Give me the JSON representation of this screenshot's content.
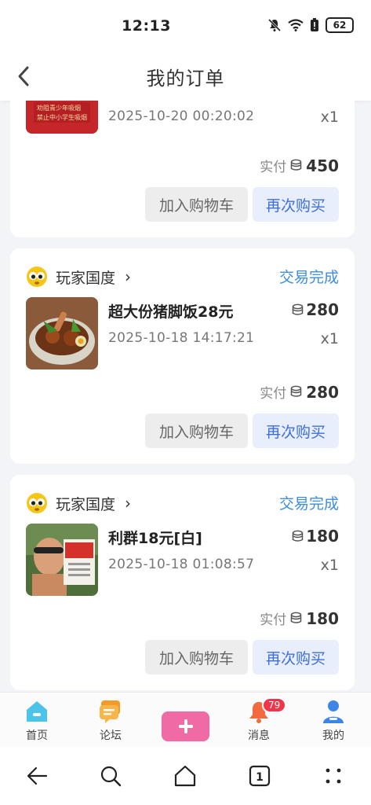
{
  "status_bar": {
    "time": "12:13",
    "battery": "62"
  },
  "header": {
    "title": "我的订单",
    "back_icon": "chevron-left-icon"
  },
  "orders": [
    {
      "shop_name": "",
      "status": "",
      "product_name": "",
      "price": "",
      "time": "2025-10-20 00:20:02",
      "qty": "x1",
      "paid_label": "实付",
      "paid_amount": "450",
      "cart_button": "加入购物车",
      "rebuy_button": "再次购买",
      "thumb_text": [
        "劝阻青少年吸烟",
        "禁止中小学生吸烟"
      ]
    },
    {
      "shop_name": "玩家国度",
      "status": "交易完成",
      "product_name": "超大份猪脚饭28元",
      "price": "280",
      "time": "2025-10-18 14:17:21",
      "qty": "x1",
      "paid_label": "实付",
      "paid_amount": "280",
      "cart_button": "加入购物车",
      "rebuy_button": "再次购买"
    },
    {
      "shop_name": "玩家国度",
      "status": "交易完成",
      "product_name": "利群18元[白]",
      "price": "180",
      "time": "2025-10-18 01:08:57",
      "qty": "x1",
      "paid_label": "实付",
      "paid_amount": "180",
      "cart_button": "加入购物车",
      "rebuy_button": "再次购买"
    }
  ],
  "bottom_nav": {
    "items": [
      {
        "label": "首页",
        "icon": "home-icon"
      },
      {
        "label": "论坛",
        "icon": "forum-icon"
      },
      {
        "label": "",
        "icon": "plus-icon"
      },
      {
        "label": "消息",
        "icon": "bell-icon",
        "badge": "79"
      },
      {
        "label": "我的",
        "icon": "profile-icon"
      }
    ]
  },
  "colors": {
    "accent_blue": "#3d8ddf",
    "rebuy_text": "#3d6fd8",
    "post_pink": "#f06aa5",
    "badge_red": "#f0354a"
  }
}
